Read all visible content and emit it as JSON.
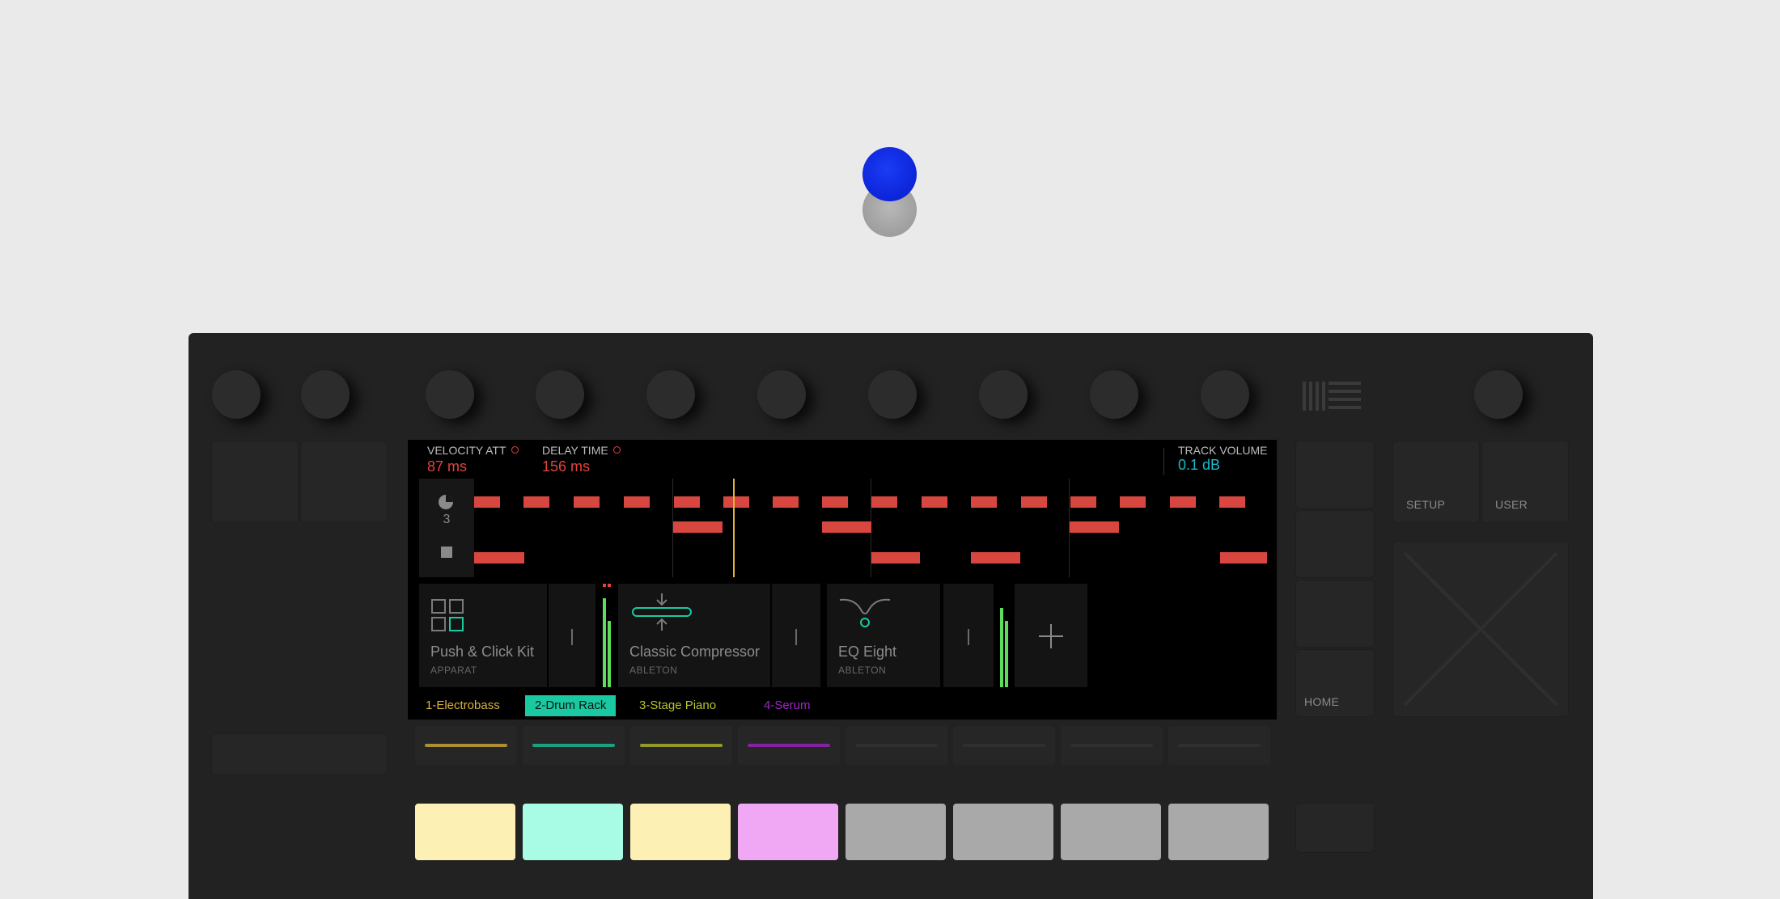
{
  "params": {
    "velocity_att": {
      "name": "VELOCITY ATT",
      "value": "87 ms"
    },
    "delay_time": {
      "name": "DELAY TIME",
      "value": "156 ms"
    },
    "track_volume": {
      "name": "TRACK VOLUME",
      "value": "0.1 dB"
    }
  },
  "clip": {
    "loop_count": "3"
  },
  "devices": [
    {
      "title": "Push & Click Kit",
      "maker": "APPARAT"
    },
    {
      "title": "Classic Compressor",
      "maker": "ABLETON"
    },
    {
      "title": "EQ Eight",
      "maker": "ABLETON"
    }
  ],
  "tracks": [
    {
      "label": "1-Electrobass",
      "color": "#d9b23a",
      "selected": false
    },
    {
      "label": "2-Drum Rack",
      "color": "#19c9a1",
      "selected": true
    },
    {
      "label": "3-Stage Piano",
      "color": "#b8c22a",
      "selected": false
    },
    {
      "label": "4-Serum",
      "color": "#a323c9",
      "selected": false
    }
  ],
  "buttons": {
    "setup": "SETUP",
    "user": "USER",
    "home": "HOME"
  },
  "pad_colors": [
    "#fdf0b4",
    "#a8fbe4",
    "#fdf0b4",
    "#f0a8f5",
    "#a9a9a9",
    "#a9a9a9",
    "#a9a9a9",
    "#a9a9a9"
  ],
  "colors": {
    "accent_red": "#e0443c",
    "volume_cyan": "#19b9c9",
    "playhead": "#e3b634"
  },
  "icons": [
    "loop-icon",
    "stop-icon",
    "drum-rack-icon",
    "compressor-icon",
    "eq-icon",
    "plus-icon",
    "ableton-logo-icon"
  ]
}
